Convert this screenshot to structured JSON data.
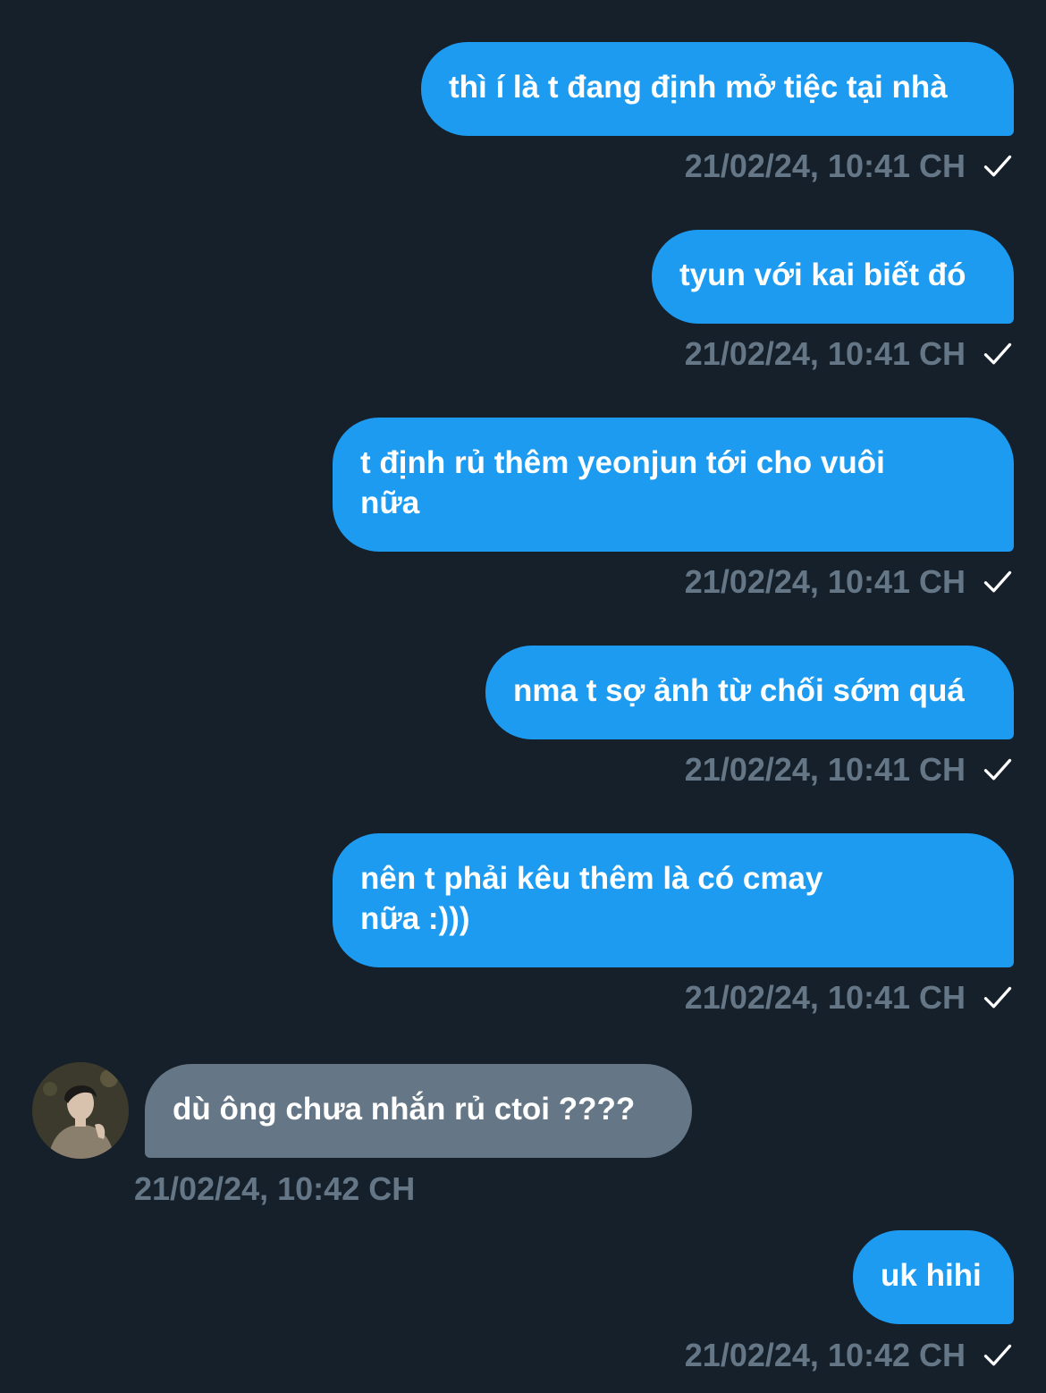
{
  "messages": [
    {
      "direction": "out",
      "text": "thì í là t đang định mở tiệc tại nhà",
      "timestamp": "21/02/24, 10:41 CH",
      "status_icon": "check-icon"
    },
    {
      "direction": "out",
      "text": "tyun với kai biết đó",
      "timestamp": "21/02/24, 10:41 CH",
      "status_icon": "check-icon"
    },
    {
      "direction": "out",
      "text": "t định rủ thêm yeonjun tới cho vuôi nữa",
      "timestamp": "21/02/24, 10:41 CH",
      "status_icon": "check-icon"
    },
    {
      "direction": "out",
      "text": "nma t sợ ảnh từ chối sớm quá",
      "timestamp": "21/02/24, 10:41 CH",
      "status_icon": "check-icon"
    },
    {
      "direction": "out",
      "text": "nên t phải kêu thêm là có cmay nữa :)))",
      "timestamp": "21/02/24, 10:41 CH",
      "status_icon": "check-icon"
    },
    {
      "direction": "in",
      "text": "dù ông chưa nhắn rủ ctoi ????",
      "timestamp": "21/02/24, 10:42 CH",
      "avatar_icon": "avatar"
    },
    {
      "direction": "out",
      "text": "uk hihi",
      "timestamp": "21/02/24, 10:42 CH",
      "status_icon": "check-icon"
    }
  ],
  "colors": {
    "background": "#15202b",
    "outgoing_bubble": "#1d9bf0",
    "incoming_bubble": "#657786",
    "timestamp": "#657786",
    "text": "#ffffff"
  }
}
